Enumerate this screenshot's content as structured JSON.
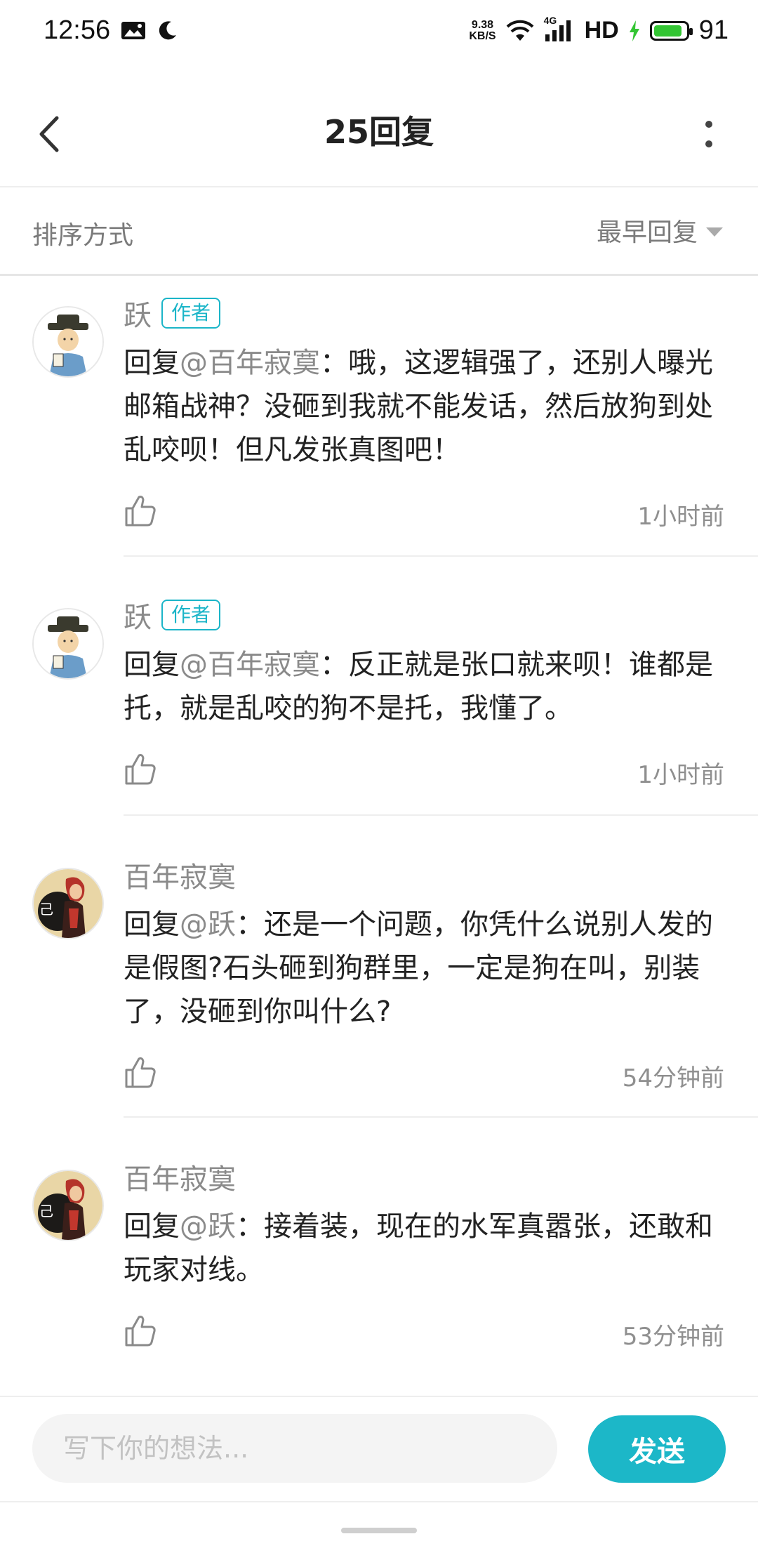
{
  "status_bar": {
    "time": "12:56",
    "net_speed_value": "9.38",
    "net_speed_unit": "KB/S",
    "network": "4G",
    "hd": "HD",
    "battery": "91",
    "battery_level": 0.91,
    "battery_color": "#33c533"
  },
  "header": {
    "title": "25回复"
  },
  "sort": {
    "label": "排序方式",
    "selected": "最早回复"
  },
  "comments": [
    {
      "name": "跃",
      "badge": "作者",
      "reply_prefix": "回复",
      "mention": "@百年寂寞",
      "text": "：哦，这逻辑强了，还别人曝光邮箱战神？没砸到我就不能发话，然后放狗到处乱咬呗！但凡发张真图吧！",
      "time": "1小时前",
      "avatar": "scholar-avatar"
    },
    {
      "name": "跃",
      "badge": "作者",
      "reply_prefix": "回复",
      "mention": "@百年寂寞",
      "text": "：反正就是张口就来呗！谁都是托，就是乱咬的狗不是托，我懂了。",
      "time": "1小时前",
      "avatar": "scholar-avatar"
    },
    {
      "name": "百年寂寞",
      "badge": "",
      "reply_prefix": "回复",
      "mention": "@跃",
      "text": "：还是一个问题，你凭什么说别人发的是假图?石头砸到狗群里，一定是狗在叫，别装了，没砸到你叫什么?",
      "time": "54分钟前",
      "avatar": "redhair-avatar"
    },
    {
      "name": "百年寂寞",
      "badge": "",
      "reply_prefix": "回复",
      "mention": "@跃",
      "text": "：接着装，现在的水军真嚣张，还敢和玩家对线。",
      "time": "53分钟前",
      "avatar": "redhair-avatar"
    }
  ],
  "input": {
    "placeholder": "写下你的想法...",
    "send_label": "发送"
  },
  "colors": {
    "accent": "#1cb7c8",
    "muted_text": "#8a8a8a"
  }
}
